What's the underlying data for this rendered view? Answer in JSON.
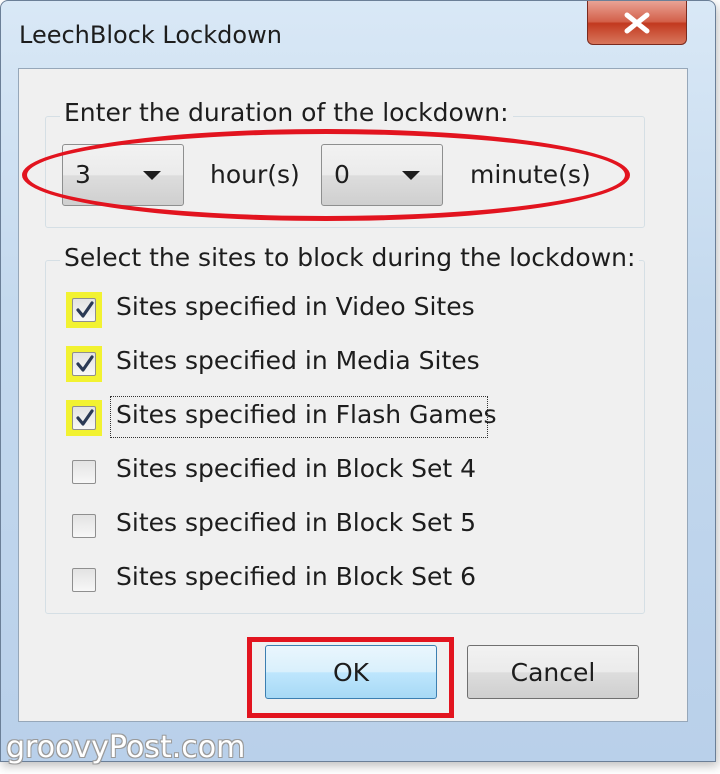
{
  "window": {
    "title": "LeechBlock Lockdown",
    "close_icon": "close-icon"
  },
  "duration": {
    "label": "Enter the duration of the lockdown:",
    "hours_value": "3",
    "hours_unit": "hour(s)",
    "minutes_value": "0",
    "minutes_unit": "minute(s)"
  },
  "sites": {
    "label": "Select the sites to block during the lockdown:",
    "items": [
      {
        "label": "Sites specified in Video Sites",
        "checked": true
      },
      {
        "label": "Sites specified in Media Sites",
        "checked": true
      },
      {
        "label": "Sites specified in Flash Games",
        "checked": true
      },
      {
        "label": "Sites specified in Block Set 4",
        "checked": false
      },
      {
        "label": "Sites specified in Block Set 5",
        "checked": false
      },
      {
        "label": "Sites specified in Block Set 6",
        "checked": false
      }
    ]
  },
  "buttons": {
    "ok_label": "OK",
    "cancel_label": "Cancel"
  },
  "watermark": "groovyPost.com",
  "colors": {
    "annotation_red": "#e2141f",
    "checkbox_highlight": "#f2f231",
    "ok_button_blue": "#bee6fd"
  }
}
